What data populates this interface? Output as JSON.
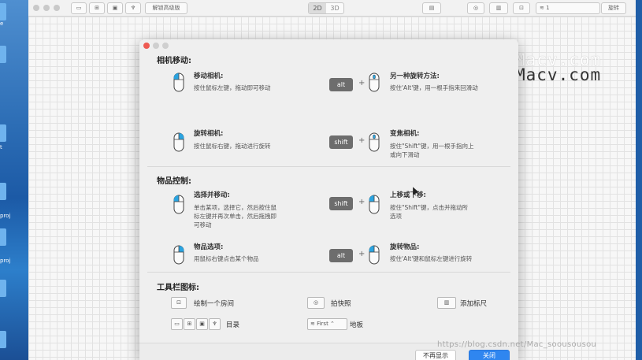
{
  "desktop": {
    "labels": [
      "e",
      "t",
      "proj",
      "proj"
    ]
  },
  "toolbar": {
    "unlock_label": "解锁高级版",
    "view_2d": "2D",
    "view_3d": "3D",
    "floor_value": "1",
    "rotate_label": "旋转"
  },
  "watermark": {
    "line1": "Macv.com",
    "line2": "Macv.com"
  },
  "dialog": {
    "camera": {
      "title": "相机移动:",
      "move": {
        "title": "移动相机:",
        "desc": "按住鼠标左键，拖动即可移动"
      },
      "alt_rotate": {
        "key": "alt",
        "title": "另一种旋转方法:",
        "desc": "按住'Alt'键，用一根手指来回滑动"
      },
      "rotate": {
        "title": "旋转相机:",
        "desc": "按住鼠标右键，拖动进行旋转"
      },
      "zoom": {
        "key": "shift",
        "title": "变焦相机:",
        "desc1": "按住\"Shift\"键，用一根手指向上",
        "desc2": "或向下滑动"
      }
    },
    "objects": {
      "title": "物品控制:",
      "select": {
        "title": "选择并移动:",
        "desc1": "单击某项，选择它，然后按住鼠",
        "desc2": "标左键并再次单击，然后拖拽即",
        "desc3": "可移动"
      },
      "updown": {
        "key": "shift",
        "title": "上移或下移:",
        "desc1": "按住\"Shift\"键，点击并拖动所",
        "desc2": "选项"
      },
      "options": {
        "title": "物品选项:",
        "desc": "用鼠标右键点击某个物品"
      },
      "rotate": {
        "key": "alt",
        "title": "旋转物品:",
        "desc": "按住'Alt'键和鼠标左键进行旋转"
      }
    },
    "tools": {
      "title": "工具栏图标:",
      "draw_room": "绘制一个房间",
      "snapshot": "拍快照",
      "add_ruler": "添加标尺",
      "catalog": "目录",
      "floor_select": "First",
      "floor_label": "地板"
    },
    "footer": {
      "dont_show": "不再显示",
      "close": "关闭"
    }
  },
  "csdn_watermark": "https://blog.csdn.net/Mac_soousousou",
  "colors": {
    "accent": "#2f86f0",
    "mouse_highlight": "#2aa3e0",
    "key_bg": "#6d6d6d"
  }
}
